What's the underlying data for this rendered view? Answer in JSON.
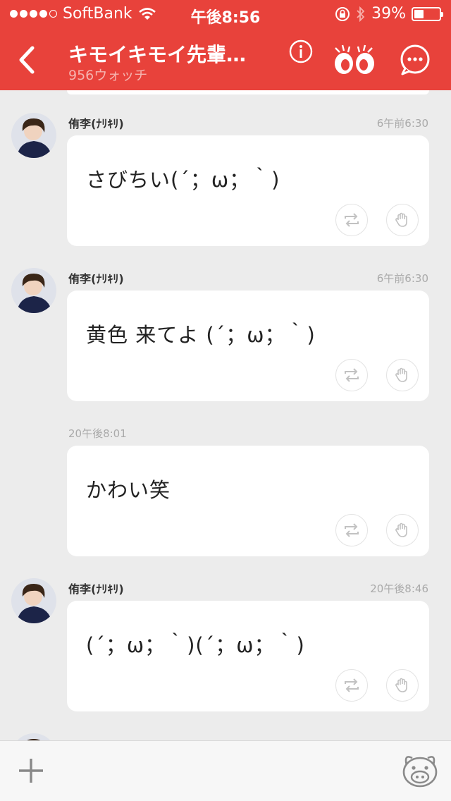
{
  "status_bar": {
    "carrier": "SoftBank",
    "time": "午後8:56",
    "battery_text": "39%",
    "battery_level": 0.39
  },
  "header": {
    "title": "キモイキモイ先輩…",
    "subtitle": "956ウォッチ",
    "color": "#e8423b",
    "icons": [
      "back-chevron-icon",
      "info-icon",
      "eyes-icon",
      "chat-bubble-icon"
    ]
  },
  "messages": [
    {
      "author": "侑李(ﾅﾘｷﾘ)",
      "time": "6午前6:30",
      "text": "さびちい(´；ω；｀)",
      "has_avatar": true
    },
    {
      "author": "侑李(ﾅﾘｷﾘ)",
      "time": "6午前6:30",
      "text": "黄色 来てよ (´；ω；｀)",
      "has_avatar": true
    },
    {
      "author": "",
      "time": "20午後8:01",
      "text": "かわい笑",
      "has_avatar": false
    },
    {
      "author": "侑李(ﾅﾘｷﾘ)",
      "time": "20午後8:46",
      "text": "(´；ω；｀)(´；ω；｀)",
      "has_avatar": true
    }
  ],
  "bottom_bar": {
    "icons": [
      "plus-icon",
      "mascot-face-icon"
    ]
  }
}
